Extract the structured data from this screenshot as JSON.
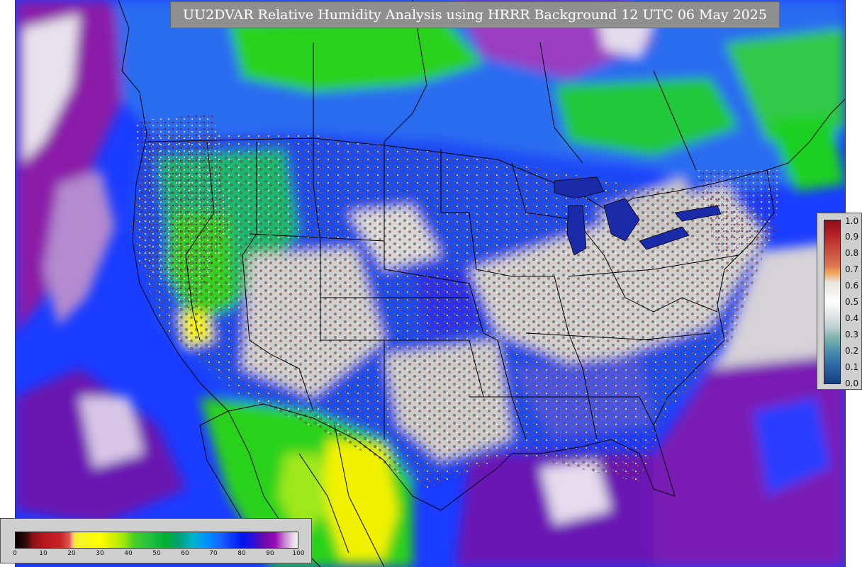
{
  "title": "UU2DVAR Relative Humidity Analysis using HRRR Background 12 UTC 06 May 2025",
  "verification_legend": {
    "ticks": [
      "1.0",
      "0.9",
      "0.8",
      "0.7",
      "0.6",
      "0.5",
      "0.4",
      "0.3",
      "0.2",
      "0.1",
      "0.0"
    ]
  },
  "rh_legend": {
    "ticks": [
      "0",
      "10",
      "20",
      "30",
      "40",
      "50",
      "60",
      "70",
      "80",
      "90",
      "100"
    ]
  },
  "colors": {
    "land_dry": "#d0d0d0",
    "ocean_moist": "#1a3cff",
    "pacific_band": "#8a1ca8",
    "canada_green": "#2bd11f",
    "mexico_yellow": "#f2f200",
    "boundaries": "#000000"
  }
}
